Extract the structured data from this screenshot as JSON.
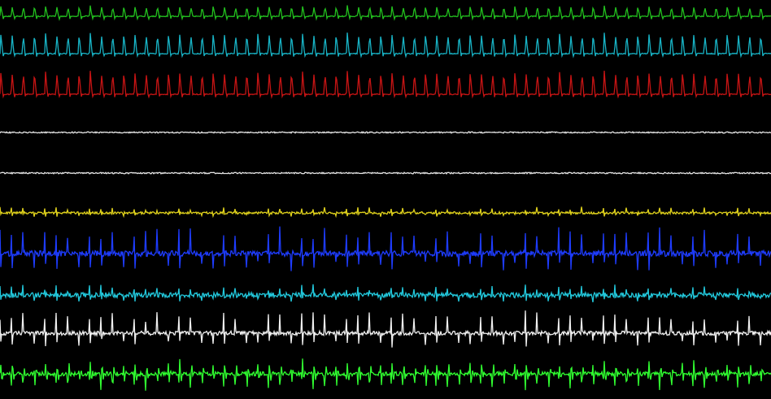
{
  "monitor": {
    "background": "#000000",
    "channels": [
      {
        "id": "ch1",
        "color": "#22c01e",
        "pattern": "pulse-up",
        "beats": 69,
        "amp": 13,
        "noise": 0.6
      },
      {
        "id": "ch2",
        "color": "#18b4c6",
        "pattern": "pulse-up",
        "beats": 69,
        "amp": 26,
        "noise": 0.6
      },
      {
        "id": "ch3",
        "color": "#c81414",
        "pattern": "pulse-up",
        "beats": 69,
        "amp": 29,
        "noise": 0.6
      },
      {
        "id": "ch4",
        "color": "#e6e6e6",
        "pattern": "flat",
        "beats": 0,
        "amp": 0,
        "noise": 0.8
      },
      {
        "id": "ch5",
        "color": "#e6e6e6",
        "pattern": "flat",
        "beats": 0,
        "amp": 0,
        "noise": 0.8
      },
      {
        "id": "ch6",
        "color": "#e0d21c",
        "pattern": "spike",
        "beats": 69,
        "amp": 6,
        "noise": 1.4
      },
      {
        "id": "ch7",
        "color": "#1e3cff",
        "pattern": "spike",
        "beats": 69,
        "amp": 30,
        "noise": 3.5
      },
      {
        "id": "ch8",
        "color": "#22c8dc",
        "pattern": "spike",
        "beats": 69,
        "amp": 10,
        "noise": 3.0
      },
      {
        "id": "ch9",
        "color": "#f0f0f0",
        "pattern": "spike",
        "beats": 69,
        "amp": 24,
        "noise": 2.5
      },
      {
        "id": "ch10",
        "color": "#30ff30",
        "pattern": "burst",
        "beats": 69,
        "amp": 22,
        "noise": 2.5
      }
    ]
  }
}
